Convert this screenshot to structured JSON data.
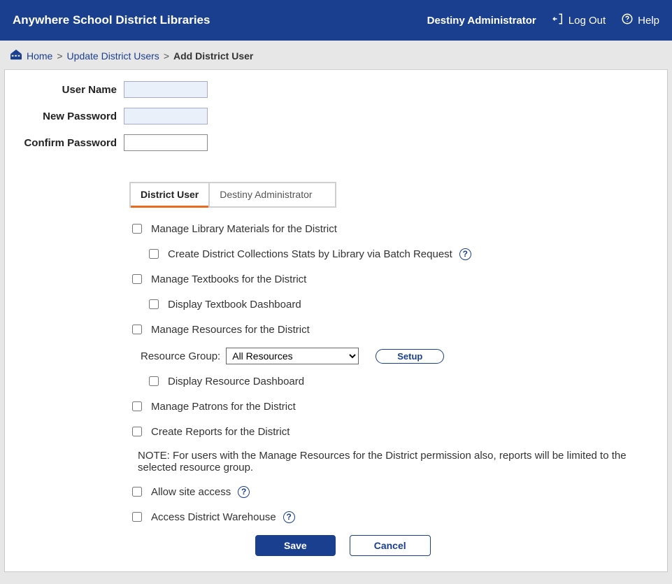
{
  "header": {
    "title": "Anywhere School District Libraries",
    "user": "Destiny Administrator",
    "logout": "Log Out",
    "help": "Help"
  },
  "breadcrumb": {
    "home": "Home",
    "sep": ">",
    "update": "Update District Users",
    "current": "Add District User"
  },
  "form": {
    "username_label": "User Name",
    "username_value": "",
    "newpw_label": "New Password",
    "newpw_value": "",
    "confirmpw_label": "Confirm Password",
    "confirmpw_value": ""
  },
  "tabs": {
    "district_user": "District User",
    "destiny_admin": "Destiny Administrator"
  },
  "perms": {
    "p1": "Manage Library Materials for the District",
    "p1a": "Create District Collections Stats by Library via Batch Request",
    "p2": "Manage Textbooks for the District",
    "p2a": "Display Textbook Dashboard",
    "p3": "Manage Resources for the District",
    "resource_group_label": "Resource Group:",
    "resource_group_value": "All Resources",
    "setup_btn": "Setup",
    "p3a": "Display Resource Dashboard",
    "p4": "Manage Patrons for the District",
    "p5": "Create Reports for the District",
    "note": "NOTE: For users with the Manage Resources for the District permission also, reports will be limited to the selected resource group.",
    "p6": "Allow site access",
    "p7": "Access District Warehouse"
  },
  "buttons": {
    "save": "Save",
    "cancel": "Cancel"
  }
}
